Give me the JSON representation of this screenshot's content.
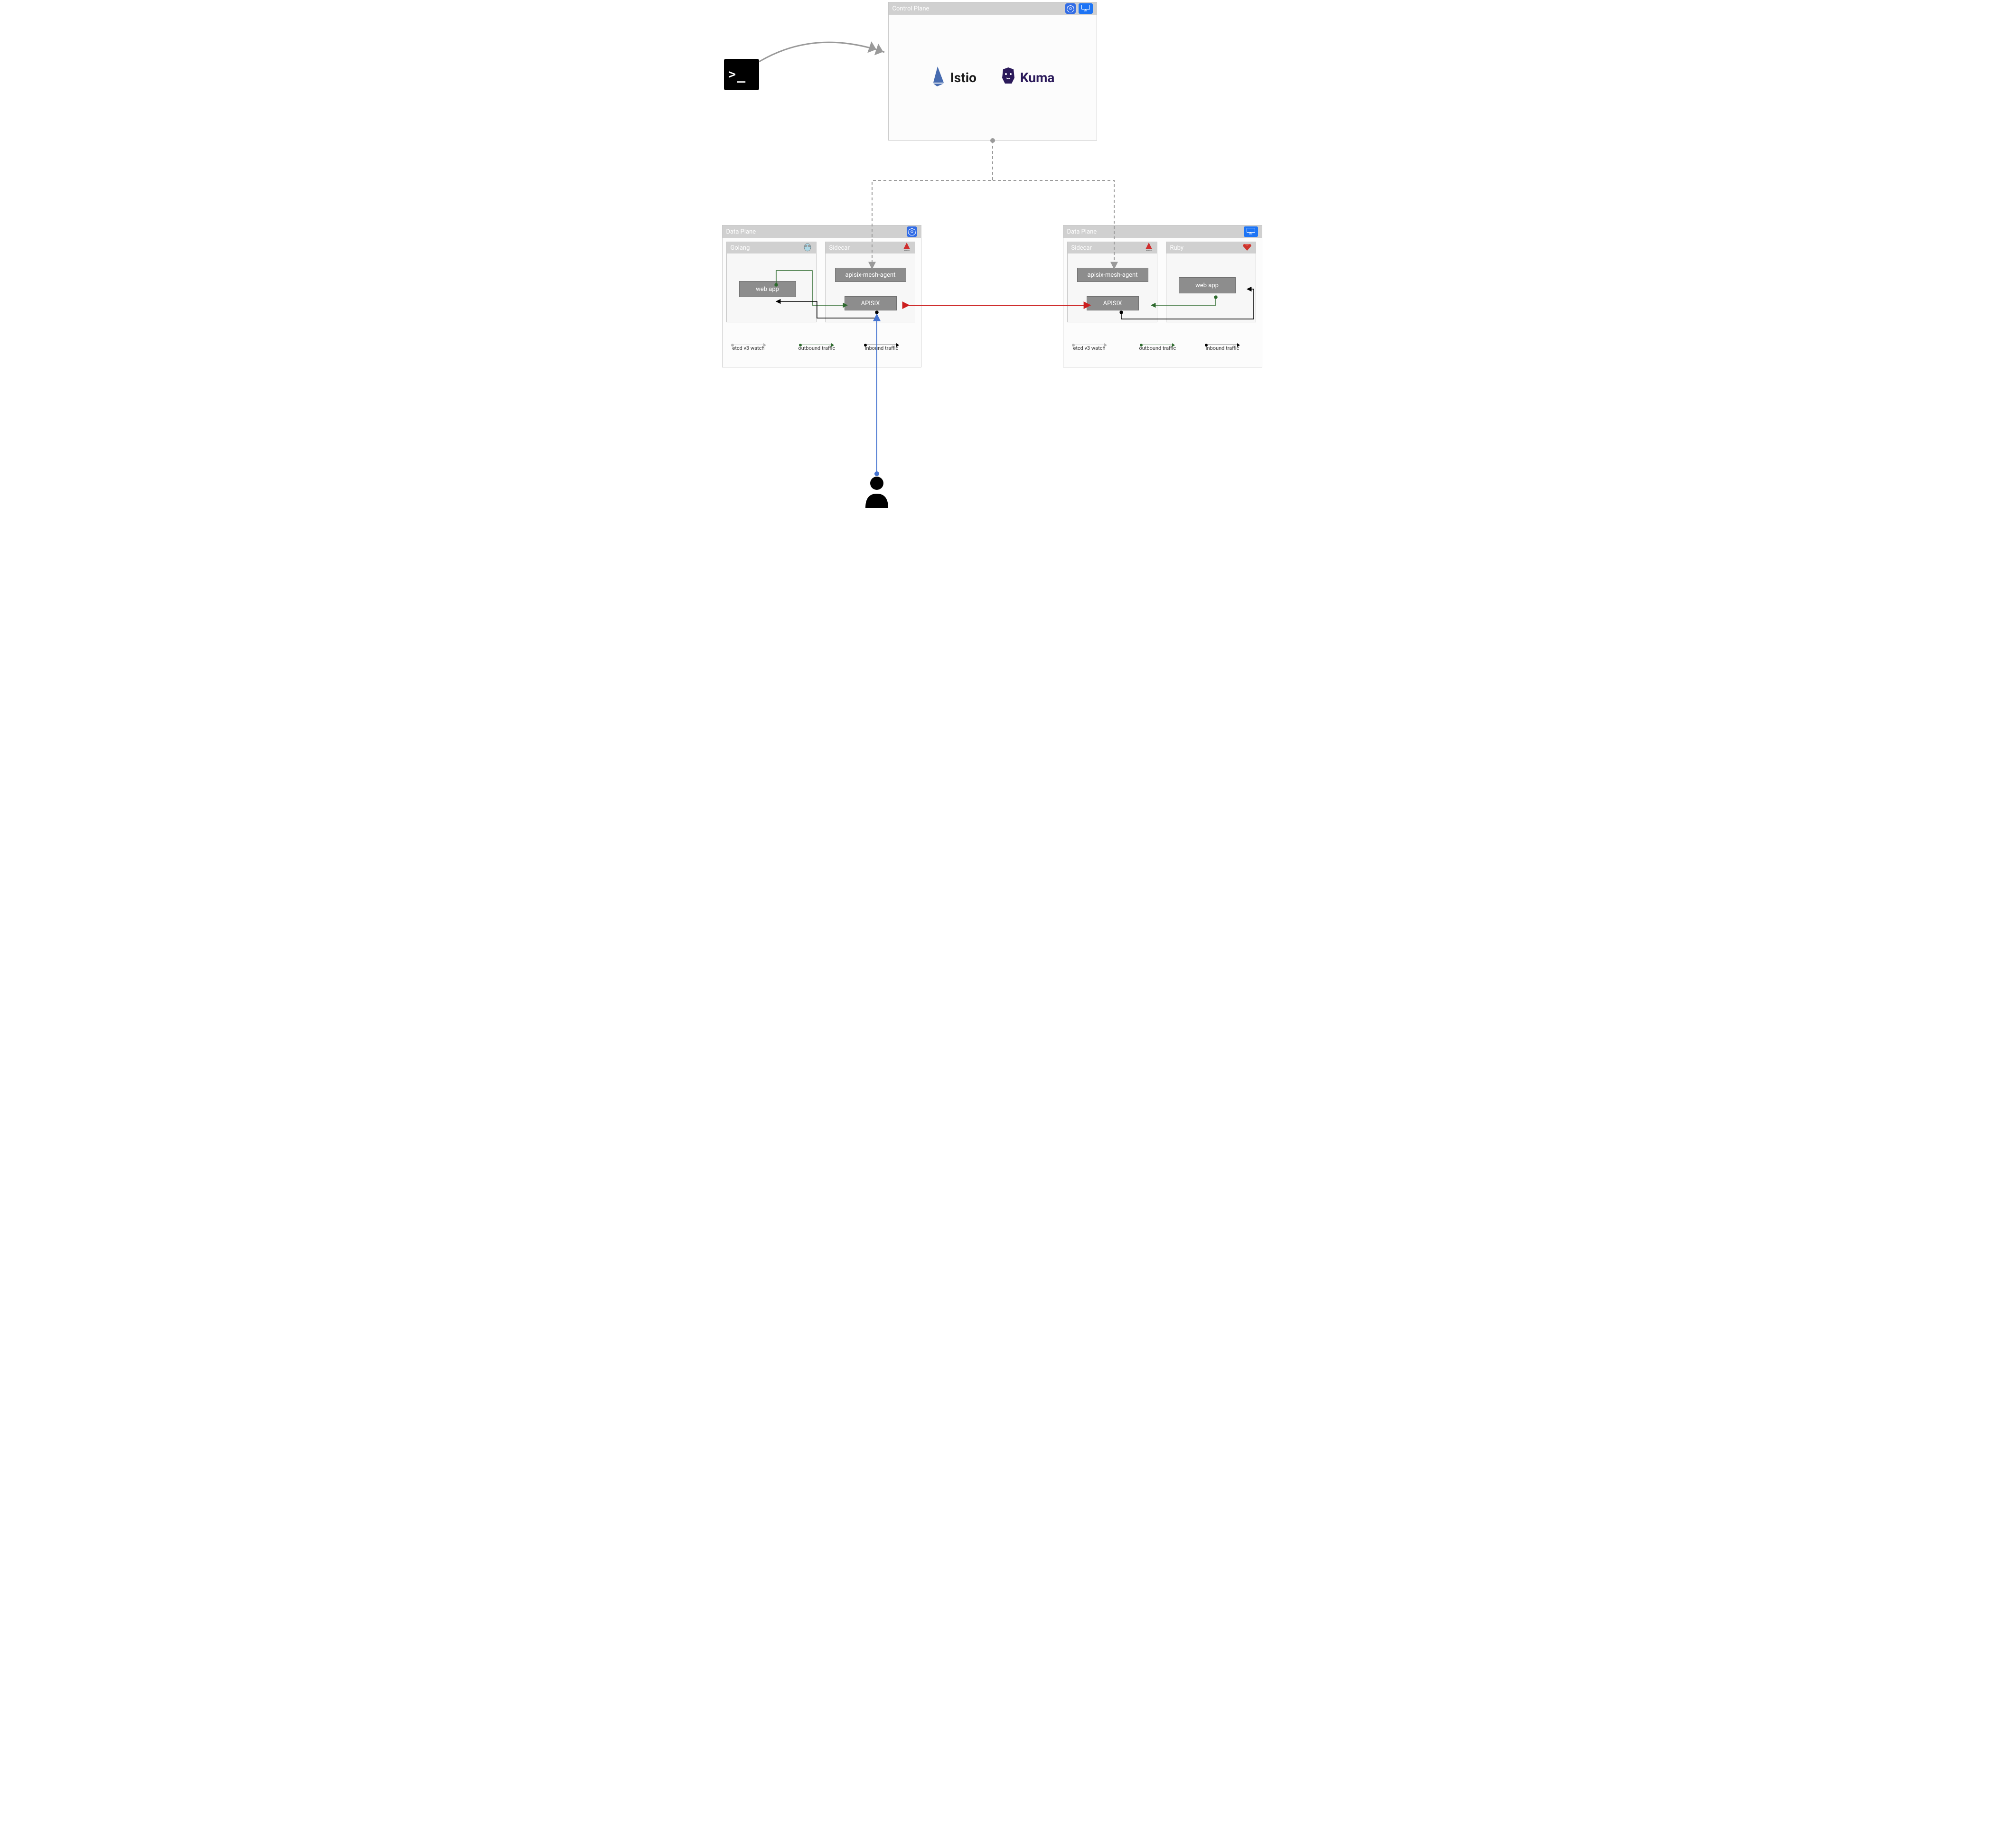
{
  "control_plane": {
    "title": "Control Plane",
    "brands": {
      "istio": "Istio",
      "kuma": "Kuma"
    },
    "badges": {
      "k8s": "kubernetes-icon",
      "vm": "VM"
    }
  },
  "data_plane_left": {
    "title": "Data Plane",
    "golang": {
      "title": "Golang",
      "box": "web app"
    },
    "sidecar": {
      "title": "Sidecar",
      "agent": "apisix-mesh-agent",
      "proxy": "APISIX"
    },
    "legend": {
      "etcd": "etcd v3 watch",
      "outbound": "outbound traffic",
      "inbound": "Inbound traffic"
    }
  },
  "data_plane_right": {
    "title": "Data Plane",
    "sidecar": {
      "title": "Sidecar",
      "agent": "apisix-mesh-agent",
      "proxy": "APISIX"
    },
    "ruby": {
      "title": "Ruby",
      "box": "web app"
    },
    "legend": {
      "etcd": "etcd v3 watch",
      "outbound": "outbound traffic",
      "inbound": "Inbound traffic"
    }
  },
  "icons": {
    "terminal": "terminal-icon",
    "user": "user-icon",
    "k8s": "kubernetes-icon",
    "vm": "vm-icon",
    "gopher": "golang-gopher-icon",
    "apisix": "apisix-icon",
    "ruby": "ruby-icon",
    "istio_sail": "istio-sail-icon",
    "kuma_bear": "kuma-bear-icon"
  },
  "vm_label": "VM"
}
